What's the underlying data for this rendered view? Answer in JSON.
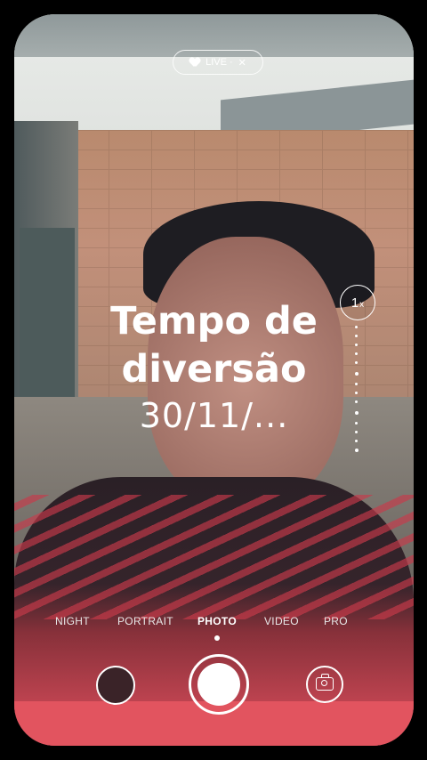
{
  "top_pill": {
    "text": "LIVE ·",
    "extra": "✕"
  },
  "overlay": {
    "title_line1": "Tempo de",
    "title_line2": "diversão",
    "date": "30/11/..."
  },
  "zoom": {
    "label": "1",
    "suffix": "x"
  },
  "modes": [
    {
      "label": "NIGHT"
    },
    {
      "label": "PORTRAIT"
    },
    {
      "label": "PHOTO"
    },
    {
      "label": "VIDEO"
    },
    {
      "label": "PRO"
    }
  ],
  "active_mode": "PHOTO",
  "icons": {
    "top_pill": "heart-icon",
    "switch_camera": "camera-switch-icon"
  }
}
